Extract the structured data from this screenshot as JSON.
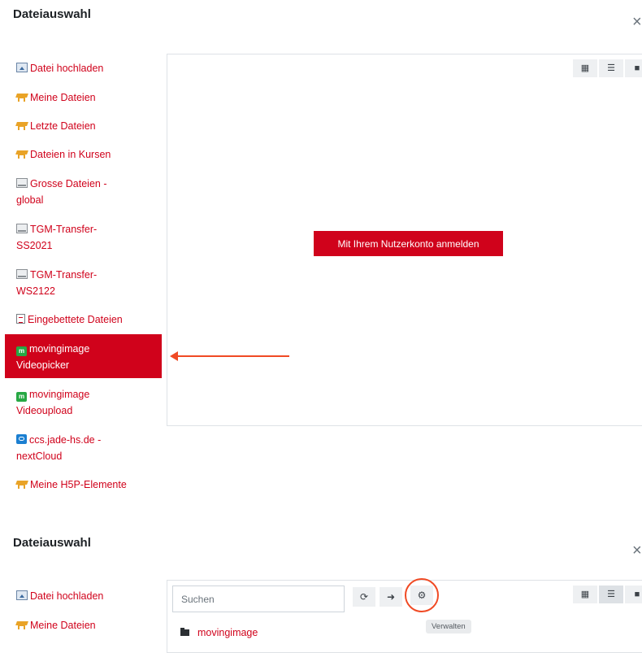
{
  "dialog1": {
    "title": "Dateiauswahl",
    "close": "×",
    "repositories": [
      {
        "label": "Datei hochladen",
        "icon": "upload-icon"
      },
      {
        "label": "Meine Dateien",
        "icon": "moodle-icon"
      },
      {
        "label": "Letzte Dateien",
        "icon": "moodle-icon"
      },
      {
        "label": "Dateien in Kursen",
        "icon": "moodle-icon"
      },
      {
        "label": "Grosse Dateien -",
        "label2": "global",
        "icon": "drive-icon"
      },
      {
        "label": "TGM-Transfer-",
        "label2": "SS2021",
        "icon": "drive-icon"
      },
      {
        "label": "TGM-Transfer-",
        "label2": "WS2122",
        "icon": "drive-icon"
      },
      {
        "label": "Eingebettete Dateien",
        "icon": "embedded-file-icon"
      },
      {
        "label": "movingimage",
        "label2": "Videopicker",
        "icon": "movingimage-icon",
        "active": true
      },
      {
        "label": "movingimage",
        "label2": "Videoupload",
        "icon": "movingimage-icon"
      },
      {
        "label": "ccs.jade-hs.de -",
        "label2": "nextCloud",
        "icon": "nextcloud-icon"
      },
      {
        "label": "Meine H5P-Elemente",
        "icon": "moodle-icon"
      }
    ],
    "login_button": "Mit Ihrem Nutzerkonto anmelden",
    "view_buttons": [
      "grid-view-icon",
      "list-view-icon",
      "folder-view-icon"
    ]
  },
  "dialog2": {
    "title": "Dateiauswahl",
    "close": "×",
    "repositories": [
      {
        "label": "Datei hochladen",
        "icon": "upload-icon"
      },
      {
        "label": "Meine Dateien",
        "icon": "moodle-icon"
      }
    ],
    "search_placeholder": "Suchen",
    "tool_icons": [
      "refresh-icon",
      "logout-icon",
      "gear-icon"
    ],
    "tooltip": "Verwalten",
    "folder": "movingimage"
  },
  "colors": {
    "accent": "#d0021b",
    "annotation": "#f04a24"
  }
}
